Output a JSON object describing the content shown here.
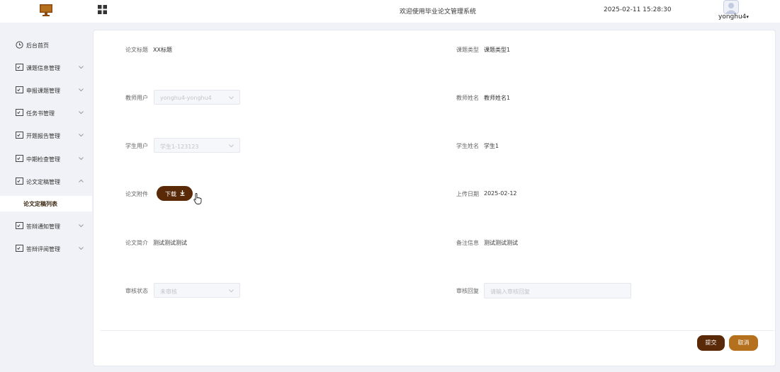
{
  "header": {
    "title": "欢迎使用毕业论文管理系统",
    "datetime": "2025-02-11 15:28:30",
    "username": "yonghu4",
    "dropdown_caret": "▾"
  },
  "sidebar": {
    "home": "后台首页",
    "items": [
      {
        "label": "课题信息管理"
      },
      {
        "label": "申报课题管理"
      },
      {
        "label": "任务书管理"
      },
      {
        "label": "开题报告管理"
      },
      {
        "label": "中期检查管理"
      },
      {
        "label": "论文定稿管理"
      },
      {
        "label": "答辩通知管理"
      },
      {
        "label": "答辩评阅管理"
      }
    ],
    "active_sub": "论文定稿列表"
  },
  "form": {
    "title_label": "论文标题",
    "title_value": "XX标题",
    "topic_type_label": "课题类型",
    "topic_type_value": "课题类型1",
    "teacher_user_label": "教师用户",
    "teacher_user_value": "yonghu4-yonghu4",
    "teacher_name_label": "教师姓名",
    "teacher_name_value": "教师姓名1",
    "student_user_label": "学生用户",
    "student_user_value": "学生1-123123",
    "student_name_label": "学生姓名",
    "student_name_value": "学生1",
    "attachment_label": "论文附件",
    "download_label": "下载",
    "upload_date_label": "上传日期",
    "upload_date_value": "2025-02-12",
    "summary_label": "论文简介",
    "summary_value": "测试测试测试",
    "remark_label": "备注信息",
    "remark_value": "测试测试测试",
    "review_status_label": "审核状态",
    "review_status_value": "未审核",
    "review_reply_label": "审核回复",
    "review_reply_placeholder": "请输入审核回复"
  },
  "actions": {
    "submit": "提交",
    "cancel": "取消"
  },
  "colors": {
    "primary_dark": "#5a2a08",
    "primary_light": "#b5701e",
    "background": "#f0f2f7"
  }
}
